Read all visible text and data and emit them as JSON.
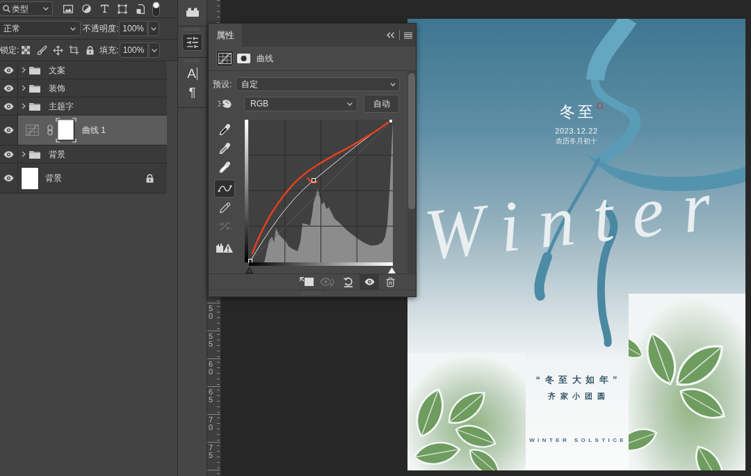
{
  "layers_panel": {
    "filter": {
      "label": "类型"
    },
    "filter_switch": {
      "on": true
    },
    "blend_mode": {
      "value": "正常"
    },
    "opacity": {
      "label": "不透明度:",
      "value": "100%"
    },
    "lock": {
      "label": "锁定:"
    },
    "fill": {
      "label": "填充:",
      "value": "100%"
    },
    "layers": [
      {
        "kind": "group",
        "name": "文案",
        "visible": true,
        "expanded": false,
        "locked": false,
        "selected": false
      },
      {
        "kind": "group",
        "name": "装饰",
        "visible": true,
        "expanded": false,
        "locked": false,
        "selected": false
      },
      {
        "kind": "group",
        "name": "主题字",
        "visible": true,
        "expanded": false,
        "locked": false,
        "selected": false
      },
      {
        "kind": "adjustment",
        "name": "曲线 1",
        "visible": true,
        "locked": false,
        "selected": true
      },
      {
        "kind": "group",
        "name": "背景",
        "visible": true,
        "expanded": false,
        "locked": false,
        "selected": false
      },
      {
        "kind": "pixel",
        "name": "背景",
        "visible": true,
        "locked": true,
        "selected": false
      }
    ]
  },
  "panel_dock": {
    "groups": [
      {
        "items": [
          {
            "kind": "plugins",
            "selected": false
          }
        ]
      },
      {
        "items": [
          {
            "kind": "adjustments",
            "selected": true
          }
        ]
      },
      {
        "items": [
          {
            "kind": "character",
            "glyph": "A",
            "selected": false
          },
          {
            "kind": "paragraph",
            "glyph": "¶",
            "selected": false
          }
        ]
      }
    ]
  },
  "properties_panel": {
    "tab": {
      "label": "属性",
      "selected": true
    },
    "title": "曲线",
    "view_buttons": [
      {
        "kind": "adjustment",
        "selected": true
      },
      {
        "kind": "mask",
        "selected": false
      }
    ],
    "preset": {
      "label": "预设:",
      "value": "自定"
    },
    "channel": {
      "value": "RGB"
    },
    "auto_button": {
      "label": "自动"
    },
    "tools": [
      {
        "kind": "eyedropper_shadow",
        "selected": false,
        "disabled": false
      },
      {
        "kind": "eyedropper_midtone",
        "selected": false,
        "disabled": false
      },
      {
        "kind": "eyedropper_highlight",
        "selected": false,
        "disabled": false
      },
      {
        "kind": "points",
        "selected": true,
        "disabled": false
      },
      {
        "kind": "pencil",
        "selected": false,
        "disabled": false
      },
      {
        "kind": "smooth",
        "selected": false,
        "disabled": true
      },
      {
        "kind": "clipping",
        "selected": false,
        "disabled": false
      }
    ],
    "footer_buttons": [
      {
        "kind": "clip",
        "selected": false,
        "disabled": false
      },
      {
        "kind": "view_previous",
        "selected": false,
        "disabled": true
      },
      {
        "kind": "reset",
        "selected": false,
        "disabled": false
      },
      {
        "kind": "visibility",
        "selected": true,
        "disabled": false
      },
      {
        "kind": "delete",
        "selected": false,
        "disabled": false
      }
    ]
  },
  "ruler": {
    "labels": [
      "50",
      "55",
      "60",
      "65",
      "70",
      "75"
    ]
  },
  "poster": {
    "title": "冬至",
    "date": "2023.12.22",
    "lunar_date": "农历冬月初十",
    "script_word": "Winter",
    "quote": "“冬至大如年”",
    "subtitle": "齐家小团圆",
    "tagline": "WINTER SOLSTICE"
  }
}
